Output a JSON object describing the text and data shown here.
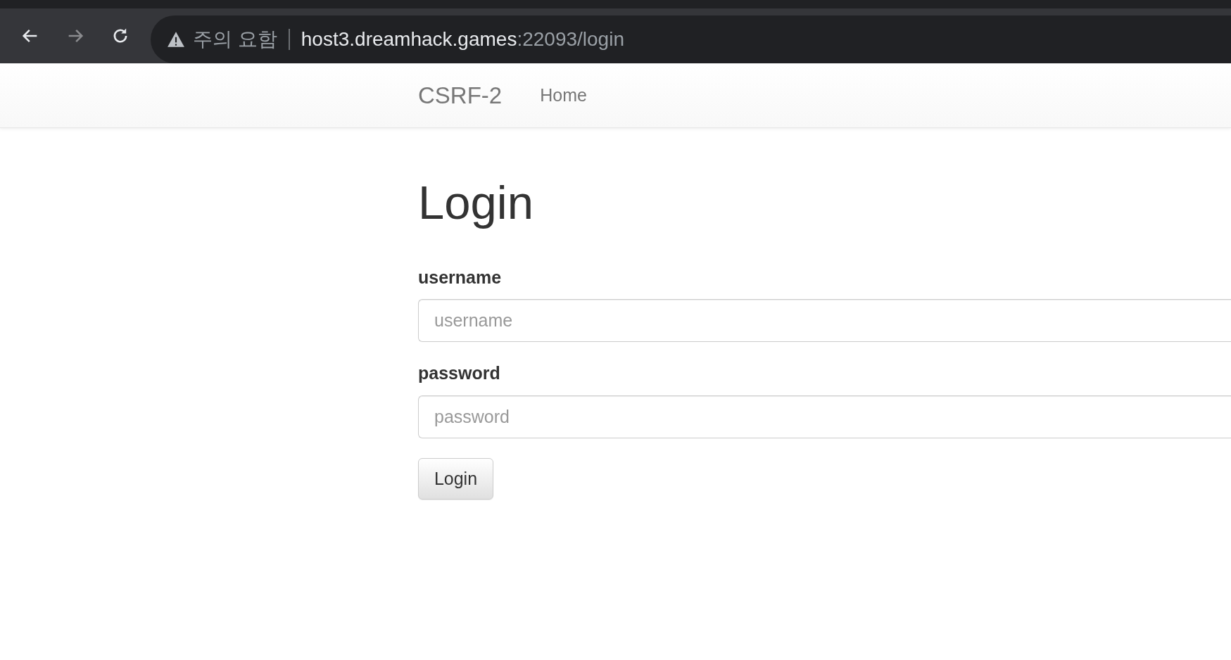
{
  "browser": {
    "security_label": "주의 요함",
    "url_host": "host3.dreamhack.games",
    "url_rest": ":22093/login"
  },
  "navbar": {
    "brand": "CSRF-2",
    "links": [
      "Home"
    ]
  },
  "heading": "Login",
  "fields": [
    {
      "label": "username",
      "placeholder": "username"
    },
    {
      "label": "password",
      "placeholder": "password"
    }
  ],
  "submit": "Login"
}
